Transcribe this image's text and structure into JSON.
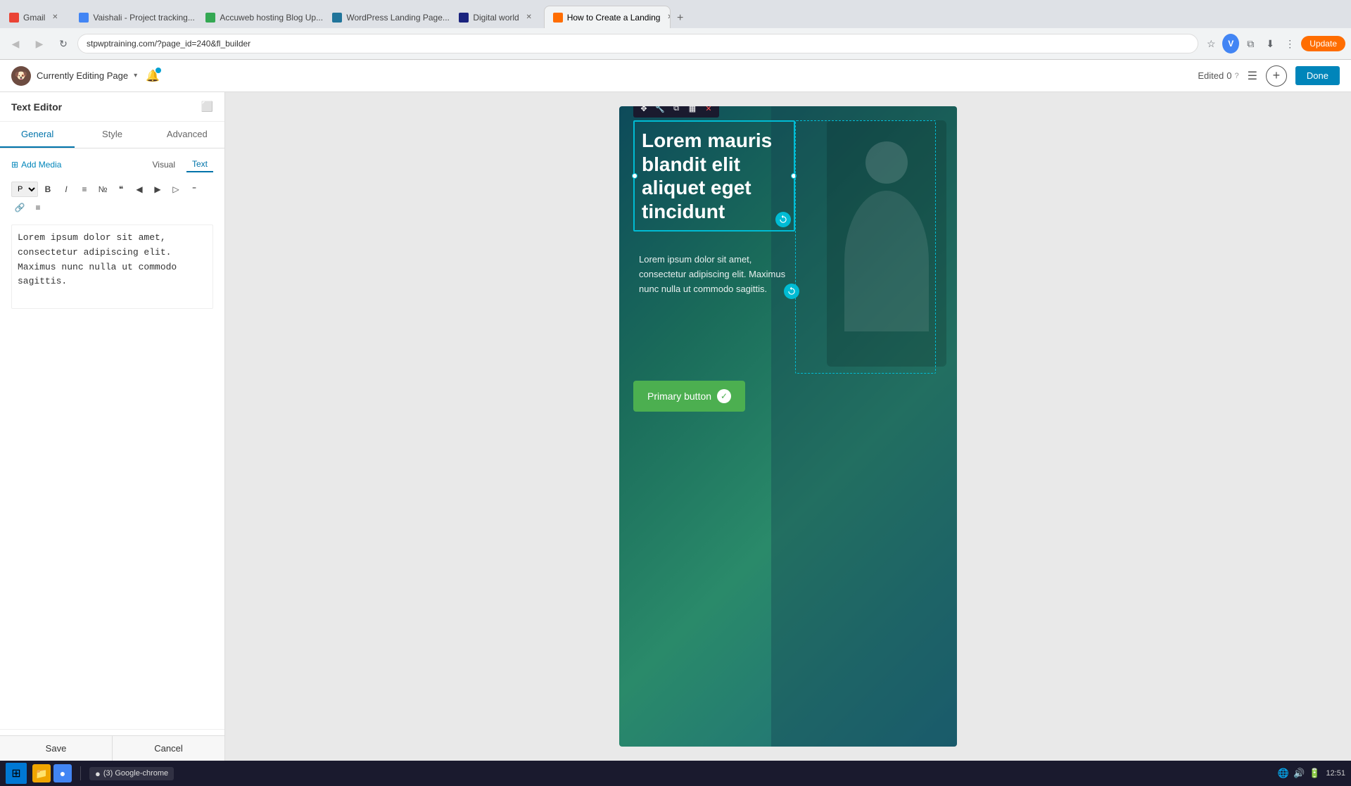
{
  "browser": {
    "tabs": [
      {
        "id": "gmail",
        "label": "Gmail",
        "favicon_class": "gmail",
        "active": false
      },
      {
        "id": "vaishali",
        "label": "Vaishali - Project tracking...",
        "favicon_class": "vaishali",
        "active": false
      },
      {
        "id": "accuweb",
        "label": "Accuweb hosting Blog Up...",
        "favicon_class": "accuweb",
        "active": false
      },
      {
        "id": "wordpress",
        "label": "WordPress Landing Page...",
        "favicon_class": "wordpress",
        "active": false
      },
      {
        "id": "digital",
        "label": "Digital world",
        "favicon_class": "digital",
        "active": false
      },
      {
        "id": "howto",
        "label": "How to Create a Landing",
        "favicon_class": "howto",
        "active": true
      }
    ],
    "address": "stpwptraining.com/?page_id=240&fl_builder",
    "new_tab_label": "+"
  },
  "wp_header": {
    "logo_emoji": "🐶",
    "currently_editing_label": "Currently Editing Page",
    "chevron": "▾",
    "edited_label": "Edited",
    "edited_count": "0",
    "question_mark": "?",
    "done_label": "Done"
  },
  "left_panel": {
    "title": "Text Editor",
    "minimize_icon": "⬜",
    "tabs": [
      {
        "id": "general",
        "label": "General",
        "active": true
      },
      {
        "id": "style",
        "label": "Style",
        "active": false
      },
      {
        "id": "advanced",
        "label": "Advanced",
        "active": false
      }
    ],
    "add_media_label": "Add Media",
    "view_modes": [
      {
        "id": "visual",
        "label": "Visual",
        "active": false
      },
      {
        "id": "text",
        "label": "Text",
        "active": true
      }
    ],
    "toolbar_buttons": [
      "P▼",
      "B",
      "I",
      "≡",
      "№",
      "❝",
      "◀",
      "▶",
      "▶▶",
      "⁼",
      "🔗",
      "≡≡"
    ],
    "editor_content": "Lorem ipsum dolor sit amet, consectetur adipiscing elit. Maximus nunc nulla ut commodo sagittis.",
    "save_label": "Save",
    "cancel_label": "Cancel"
  },
  "canvas": {
    "heading_text": "Lorem mauris blandit elit aliquet eget tincidunt",
    "body_text": "Lorem ipsum dolor sit amet, consectetur adipiscing elit. Maximus nunc nulla ut commodo sagittis.",
    "primary_button_label": "Primary button",
    "ai_icon": "↺"
  },
  "element_toolbar": {
    "move_icon": "✥",
    "wrench_icon": "🔧",
    "copy_icon": "⧉",
    "columns_icon": "▦",
    "close_icon": "✕"
  },
  "taskbar": {
    "time": "12:51",
    "chrome_label": "(3) Google-chrome",
    "system_icons": [
      "🔊",
      "📶",
      "🔋"
    ]
  }
}
